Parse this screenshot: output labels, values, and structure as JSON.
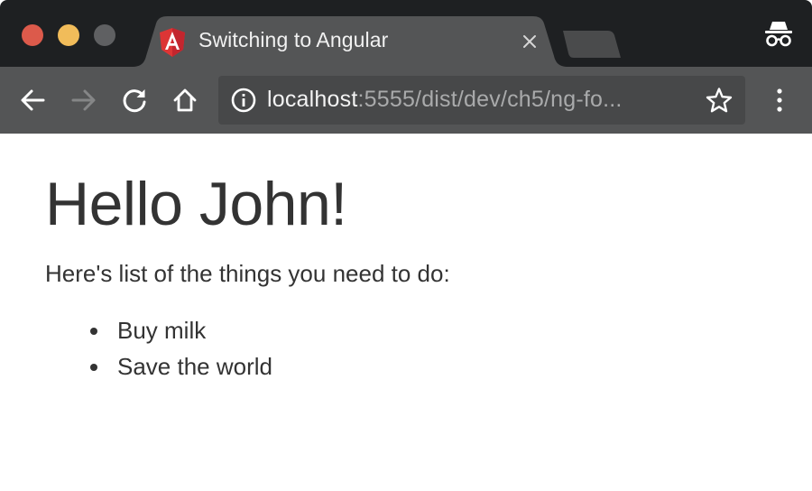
{
  "browser": {
    "tab": {
      "title": "Switching to Angular",
      "favicon": "angular-logo-icon"
    },
    "address_bar": {
      "host": "localhost",
      "path": ":5555/dist/dev/ch5/ng-fo..."
    },
    "icons": {
      "back": "back-arrow-icon",
      "forward": "forward-arrow-icon",
      "reload": "reload-icon",
      "home": "home-icon",
      "info": "info-icon",
      "bookmark": "star-icon",
      "menu": "vertical-dots-menu-icon",
      "incognito": "incognito-icon",
      "close_tab": "close-icon"
    },
    "colors": {
      "titlebar": "#1e2022",
      "active_tab": "#545556",
      "toolbar": "#545556",
      "omnibox": "#474849",
      "close_light": "#dc5a4b",
      "minimize_light": "#f1bc5a",
      "maximize_light": "#5f6062",
      "angular_red": "#dd3535"
    }
  },
  "page": {
    "heading": "Hello John!",
    "intro": "Here's list of the things you need to do:",
    "todos": [
      {
        "text": "Buy milk"
      },
      {
        "text": "Save the world"
      }
    ],
    "colors": {
      "text": "#333333",
      "background": "#ffffff"
    }
  }
}
